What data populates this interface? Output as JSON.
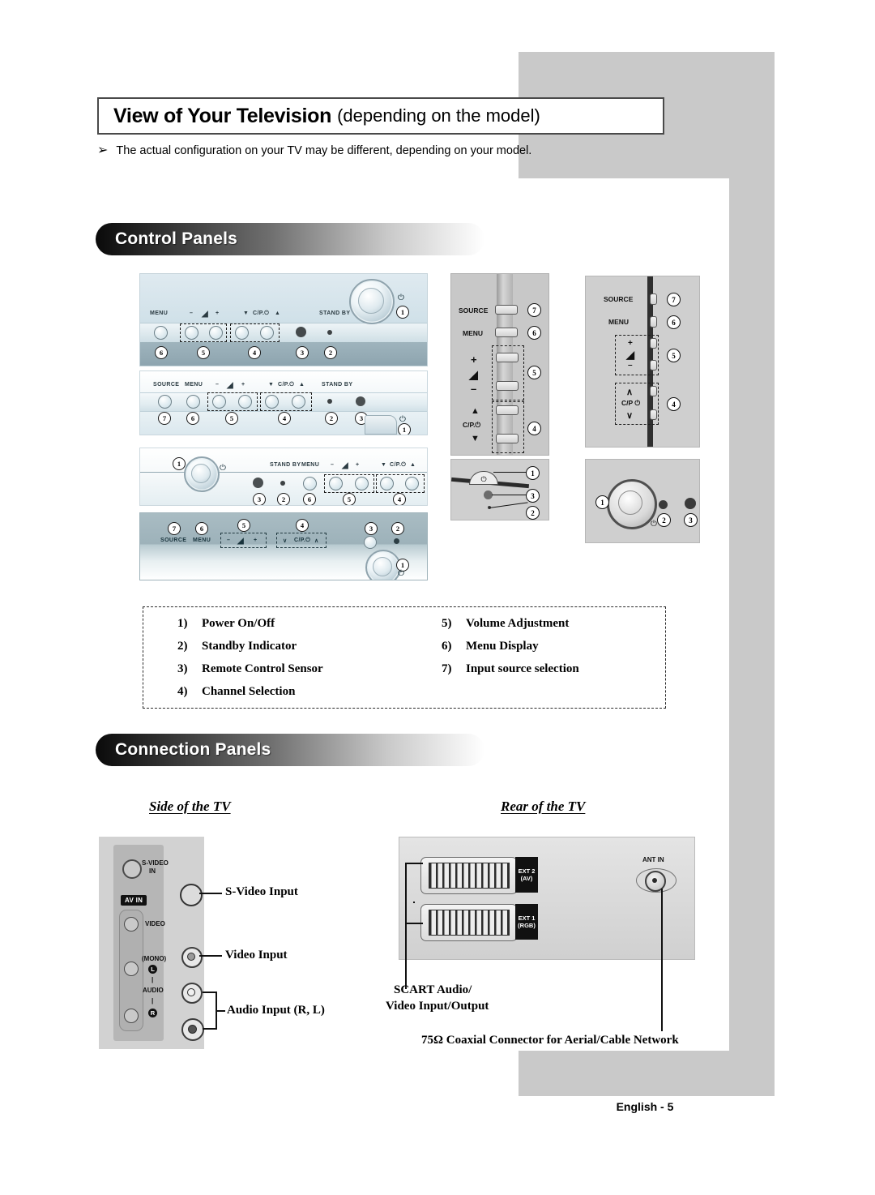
{
  "header": {
    "title_main": "View of Your Television",
    "title_sub": "(depending on the model)",
    "note_bullet": "➢",
    "note_text": "The actual configuration on your TV may be different, depending on your model."
  },
  "sections": {
    "control_panels": "Control Panels",
    "connection_panels": "Connection Panels"
  },
  "panel_labels": {
    "source": "SOURCE",
    "menu": "MENU",
    "standby": "STAND BY",
    "vol_minus": "–",
    "vol_icon": "◢",
    "vol_plus": "+",
    "ch_down": "▼",
    "ch_label": "C/P.⏻",
    "ch_up": "▲",
    "ch_down_v": "∨",
    "ch_up_v": "∧",
    "power_symbol": "⏻",
    "plus": "+",
    "minus": "–",
    "caret_up": "∧",
    "caret_down": "∨",
    "cp_power": "C/P ⏻"
  },
  "callouts": {
    "one": "1",
    "two": "2",
    "three": "3",
    "four": "4",
    "five": "5",
    "six": "6",
    "seven": "7"
  },
  "legend": {
    "left": [
      {
        "num": "1)",
        "text": "Power On/Off"
      },
      {
        "num": "2)",
        "text": "Standby Indicator"
      },
      {
        "num": "3)",
        "text": "Remote Control Sensor"
      },
      {
        "num": "4)",
        "text": "Channel Selection"
      }
    ],
    "right": [
      {
        "num": "5)",
        "text": "Volume Adjustment"
      },
      {
        "num": "6)",
        "text": "Menu Display"
      },
      {
        "num": "7)",
        "text": "Input source selection"
      }
    ]
  },
  "connection": {
    "side_heading": "Side of the TV",
    "rear_heading": "Rear of the TV",
    "side_panel": {
      "svideo_in": "S-VIDEO",
      "svideo_in2": "IN",
      "av_in": "AV IN",
      "video": "VIDEO",
      "mono": "(MONO)",
      "audio": "AUDIO",
      "left_ch": "L",
      "right_ch": "R"
    },
    "side_callouts": {
      "svideo": "S-Video Input",
      "video": "Video Input",
      "audio": "Audio Input (R, L)"
    },
    "rear_panel": {
      "ext2_line1": "EXT 2",
      "ext2_line2": "(AV)",
      "ext1_line1": "EXT 1",
      "ext1_line2": "(RGB)",
      "ant_in": "ANT IN"
    },
    "rear_callouts": {
      "scart_line1": "SCART Audio/",
      "scart_line2": "Video Input/Output",
      "coax": "75Ω Coaxial Connector for Aerial/Cable Network"
    }
  },
  "footer": {
    "page_label": "English -  5"
  }
}
